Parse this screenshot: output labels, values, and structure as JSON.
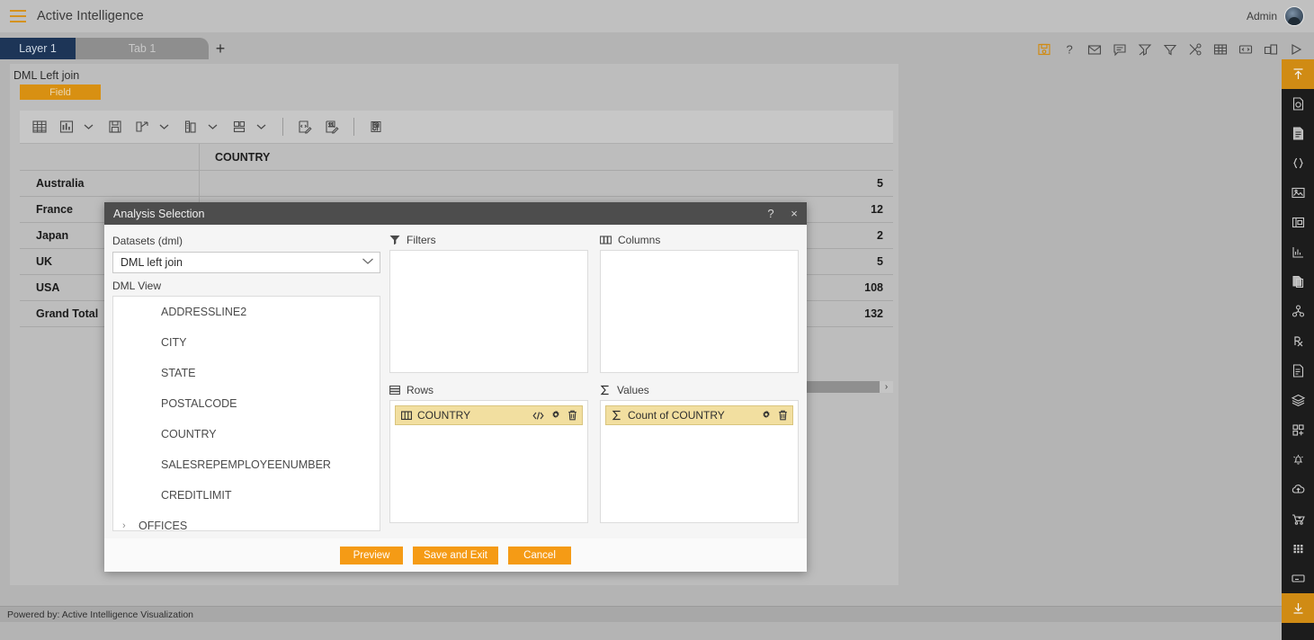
{
  "topbar": {
    "menu_icon": "hamburger-icon",
    "title": "Active Intelligence",
    "user_label": "Admin"
  },
  "tabbar": {
    "layer_tab": "Layer 1",
    "sheet_tab": "Tab 1",
    "add_tab": "+",
    "icons": [
      "save-icon",
      "help-icon",
      "mail-icon",
      "comment-icon",
      "clear-filter-icon",
      "filter-icon",
      "tools-icon",
      "grid-icon",
      "code-icon",
      "duplicate-icon",
      "play-icon"
    ]
  },
  "widget": {
    "title": "DML Left join",
    "field_button": "Field",
    "toolbar_icons": [
      "table-icon",
      "chart-icon",
      "chart-caret",
      "save-icon",
      "export-icon",
      "export-caret",
      "conditional-format-icon",
      "conditional-caret",
      "layout-icon",
      "layout-caret",
      "sep",
      "edit-code-icon",
      "edit-format-icon",
      "sep2",
      "abc-icon"
    ]
  },
  "pivot": {
    "column_header": "COUNTRY",
    "rows": [
      {
        "label": "Australia",
        "value": "5"
      },
      {
        "label": "France",
        "value": "12"
      },
      {
        "label": "Japan",
        "value": "2"
      },
      {
        "label": "UK",
        "value": "5"
      },
      {
        "label": "USA",
        "value": "108"
      },
      {
        "label": "Grand Total",
        "value": "132"
      }
    ]
  },
  "modal": {
    "title": "Analysis Selection",
    "help_btn": "?",
    "close_btn": "×",
    "datasets_label": "Datasets (dml)",
    "dataset_value": "DML left join",
    "dataset_caret": "chevron-down-icon",
    "view_label": "DML View",
    "tree_items": [
      {
        "label": "ADDRESSLINE2",
        "type": "field"
      },
      {
        "label": "CITY",
        "type": "field"
      },
      {
        "label": "STATE",
        "type": "field"
      },
      {
        "label": "POSTALCODE",
        "type": "field"
      },
      {
        "label": "COUNTRY",
        "type": "field"
      },
      {
        "label": "SALESREPEMPLOYEENUMBER",
        "type": "field"
      },
      {
        "label": "CREDITLIMIT",
        "type": "field"
      },
      {
        "label": "OFFICES",
        "type": "group",
        "caret": "›"
      }
    ],
    "zones": {
      "filters": {
        "title": "Filters",
        "icon": "filter-icon",
        "chips": []
      },
      "columns": {
        "title": "Columns",
        "icon": "columns-icon",
        "chips": []
      },
      "rows": {
        "title": "Rows",
        "icon": "rows-icon",
        "chips": [
          {
            "label": "COUNTRY",
            "icon": "column-field-icon",
            "actions": [
              "code-icon",
              "gear-icon",
              "trash-icon"
            ]
          }
        ]
      },
      "values": {
        "title": "Values",
        "icon": "sigma-icon",
        "chips": [
          {
            "label": "Count of COUNTRY",
            "icon": "sigma-icon",
            "actions": [
              "gear-icon",
              "trash-icon"
            ]
          }
        ]
      }
    },
    "buttons": [
      {
        "label": "Preview",
        "name": "preview-button"
      },
      {
        "label": "Save and Exit",
        "name": "save-and-exit-button"
      },
      {
        "label": "Cancel",
        "name": "cancel-button"
      }
    ]
  },
  "rail": {
    "top_icons": [
      {
        "name": "collapse-up-icon",
        "active": true
      },
      {
        "name": "dataset-icon",
        "active": false
      },
      {
        "name": "document-icon",
        "active": false
      },
      {
        "name": "json-icon",
        "active": false
      },
      {
        "name": "image-icon",
        "active": false
      },
      {
        "name": "frame-icon",
        "active": false
      },
      {
        "name": "chart-icon",
        "active": false
      },
      {
        "name": "copy-page-icon",
        "active": false
      },
      {
        "name": "hierarchy-icon",
        "active": false
      },
      {
        "name": "prescription-icon",
        "active": false
      },
      {
        "name": "report-icon",
        "active": false
      },
      {
        "name": "layers-icon",
        "active": false
      },
      {
        "name": "add-widget-icon",
        "active": false
      },
      {
        "name": "alert-bell-icon",
        "active": false
      },
      {
        "name": "cloud-upload-icon",
        "active": false
      },
      {
        "name": "cart-add-icon",
        "active": false
      },
      {
        "name": "grid-dots-icon",
        "active": false
      },
      {
        "name": "minimize-icon",
        "active": false
      },
      {
        "name": "expand-down-icon",
        "active": true
      }
    ]
  },
  "footer": {
    "text": "Powered by: Active Intelligence Visualization"
  },
  "colors": {
    "accent_orange": "#d89012",
    "button_orange": "#f59b15",
    "layer_tab_blue": "#1d3557",
    "chip_yellow": "#f2dfa0",
    "rail_dark": "#1c1c1c",
    "modal_header": "#4d4d4d"
  }
}
